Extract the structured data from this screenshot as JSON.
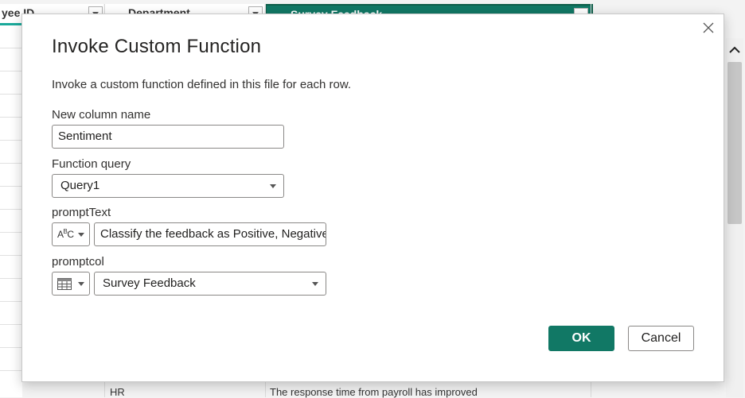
{
  "background": {
    "headers": [
      {
        "label": "yee ID"
      },
      {
        "label": "Department"
      },
      {
        "label": "Survey Feedback"
      }
    ],
    "bottom_row": {
      "department": "HR",
      "feedback": "The response time from payroll has improved"
    }
  },
  "dialog": {
    "title": "Invoke Custom Function",
    "description": "Invoke a custom function defined in this file for each row.",
    "new_column": {
      "label": "New column name",
      "value": "Sentiment"
    },
    "function_query": {
      "label": "Function query",
      "value": "Query1"
    },
    "prompt_text": {
      "label": "promptText",
      "value": "Classify the feedback as Positive, Negative,",
      "type_icon": "abc-text-type-icon"
    },
    "prompt_col": {
      "label": "promptcol",
      "value": "Survey Feedback",
      "type_icon": "table-column-type-icon"
    },
    "ok_label": "OK",
    "cancel_label": "Cancel"
  },
  "colors": {
    "accent": "#117865",
    "selected_header_border": "#0f5f4a",
    "teal_bar": "#1aa99a"
  }
}
